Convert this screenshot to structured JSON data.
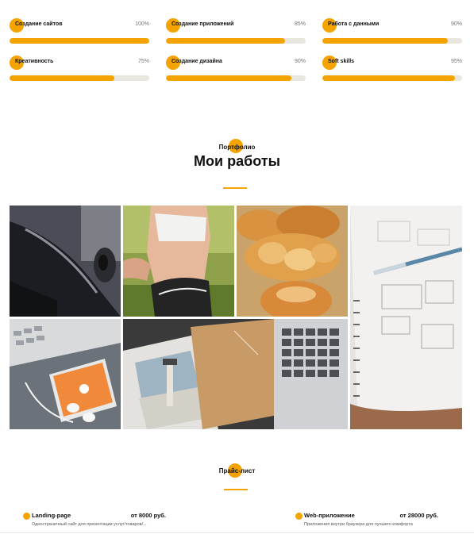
{
  "skills": [
    {
      "name": "Создание сайтов",
      "percent": "100%",
      "value": 1.0
    },
    {
      "name": "Создание приложений",
      "percent": "85%",
      "value": 0.85
    },
    {
      "name": "Работа с данными",
      "percent": "90%",
      "value": 0.9
    },
    {
      "name": "Креативность",
      "percent": "75%",
      "value": 0.75
    },
    {
      "name": "Создание дизайна",
      "percent": "90%",
      "value": 0.9
    },
    {
      "name": "Soft skills",
      "percent": "95%",
      "value": 0.95
    }
  ],
  "portfolio": {
    "label": "Портфолио",
    "title": "Мои работы"
  },
  "gallery": [
    {
      "name": "car-photo"
    },
    {
      "name": "runner-photo"
    },
    {
      "name": "bread-photo"
    },
    {
      "name": "wireframe-notebook-photo"
    },
    {
      "name": "phone-headphones-photo"
    },
    {
      "name": "photos-laptop-photo"
    }
  ],
  "pricelist": {
    "label": "Прайс-лист",
    "items": [
      {
        "name": "Landing-page",
        "price": "от 8000 руб.",
        "desc": "Одностраничный сайт для презентации услуг/товаров/..."
      },
      {
        "name": "Web-приложение",
        "price": "от 28000 руб.",
        "desc": "Приложения внутри браузера для лучшего комфорта"
      }
    ]
  },
  "colors": {
    "accent": "#f5a300",
    "track": "#e9e6df"
  }
}
